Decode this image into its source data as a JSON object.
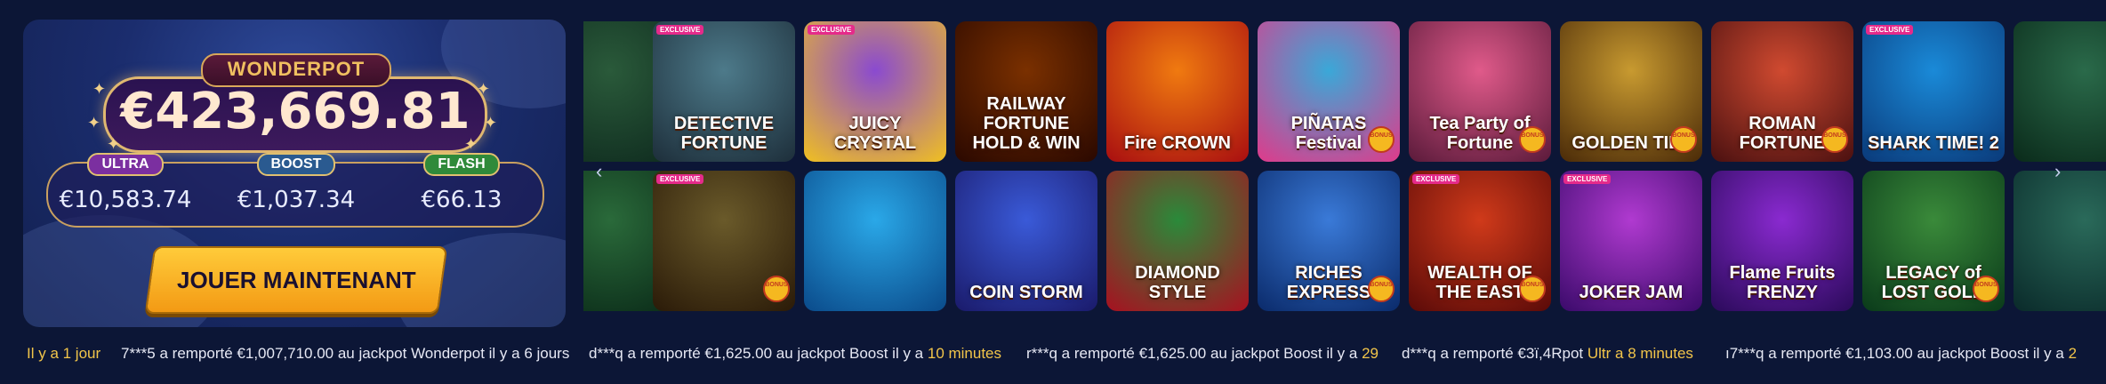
{
  "jackpot": {
    "wonderpot_label": "WONDERPOT",
    "wonderpot_amount": "€423,669.81",
    "minis": [
      {
        "label": "ULTRA",
        "amount": "€10,583.74",
        "color": "#7b2fa0"
      },
      {
        "label": "BOOST",
        "amount": "€1,037.34",
        "color": "#2a5a90"
      },
      {
        "label": "FLASH",
        "amount": "€66.13",
        "color": "#2f8a3a"
      }
    ],
    "play_label": "JOUER MAINTENANT"
  },
  "games": {
    "row1": [
      {
        "title": "",
        "bg": "#2a5a3a",
        "bg2": "#0e2a1e"
      },
      {
        "title": "DETECTIVE FORTUNE",
        "bg": "#4d7a8a",
        "bg2": "#1d2e3a",
        "badge": "EXCLUSIVE"
      },
      {
        "title": "JUICY CRYSTAL",
        "bg": "#8a4ad0",
        "bg2": "#f0c020",
        "badge": "EXCLUSIVE"
      },
      {
        "title": "RAILWAY FORTUNE HOLD & WIN",
        "bg": "#7a3000",
        "bg2": "#2a0800"
      },
      {
        "title": "Fire CROWN",
        "bg": "#f07a10",
        "bg2": "#a80e10"
      },
      {
        "title": "PIÑATAS Festival",
        "bg": "#3aa8d8",
        "bg2": "#e03a8a",
        "bonus": true
      },
      {
        "title": "Tea Party of Fortune",
        "bg": "#e05a8a",
        "bg2": "#5a1a3a",
        "bonus": true
      },
      {
        "title": "GOLDEN TILL",
        "bg": "#c89a30",
        "bg2": "#4a2a08",
        "bonus": true
      },
      {
        "title": "ROMAN FORTUNE",
        "bg": "#d04a30",
        "bg2": "#4a1010",
        "bonus": true
      },
      {
        "title": "SHARK TIME! 2",
        "bg": "#1a8ad8",
        "bg2": "#0a3a7a",
        "badge": "EXCLUSIVE"
      },
      {
        "title": "",
        "bg": "#2a6a4a",
        "bg2": "#0a2a1a"
      }
    ],
    "row2": [
      {
        "title": "",
        "bg": "#2a6a3a",
        "bg2": "#0a2a18"
      },
      {
        "title": "",
        "bg": "#6a5a2a",
        "bg2": "#2a1a08",
        "badge": "EXCLUSIVE",
        "bonus": true
      },
      {
        "title": "",
        "bg": "#2aa8e8",
        "bg2": "#0a4a8a"
      },
      {
        "title": "COIN STORM",
        "bg": "#3a5ad8",
        "bg2": "#1a1a6a"
      },
      {
        "title": "DIAMOND STYLE",
        "bg": "#2a8a3a",
        "bg2": "#a81020"
      },
      {
        "title": "RICHES EXPRESS",
        "bg": "#3a7ad8",
        "bg2": "#0a2a6a",
        "bonus": true
      },
      {
        "title": "WEALTH OF THE EAST",
        "bg": "#d03a1a",
        "bg2": "#5a0a08",
        "badge": "EXCLUSIVE",
        "bonus": true
      },
      {
        "title": "JOKER JAM",
        "bg": "#b03ad0",
        "bg2": "#3a0a6a",
        "badge": "EXCLUSIVE"
      },
      {
        "title": "Flame Fruits FRENZY",
        "bg": "#8a2ad0",
        "bg2": "#2a0a5a"
      },
      {
        "title": "LEGACY of LOST GOLD",
        "bg": "#3a8a3a",
        "bg2": "#0a3a1a",
        "bonus": true
      },
      {
        "title": "",
        "bg": "#2a6a5a",
        "bg2": "#0a2a2a"
      }
    ],
    "bonus_label": "BONUS",
    "arrow_left": "‹",
    "arrow_right": "›"
  },
  "ticker": [
    {
      "text": "Il y a 1 jour",
      "time_only": true
    },
    {
      "text": "7***5 a remporté €1,007,710.00 au jackpot Wonderpot il y a 6 jours"
    },
    {
      "text": "d***q a remporté €1,625.00 au jackpot Boost il y a",
      "time": "10 minutes"
    },
    {
      "text": "r***q a remporté €1,625.00 au jackpot Boost il y a",
      "time": "29"
    },
    {
      "text": "d***q a remporté €3ï,4Rpot",
      "time": "Ultr a 8 minutes"
    },
    {
      "text": "ı7***q a remporté €1,103.00 au jackpot Boost il y a",
      "time": "2"
    }
  ]
}
